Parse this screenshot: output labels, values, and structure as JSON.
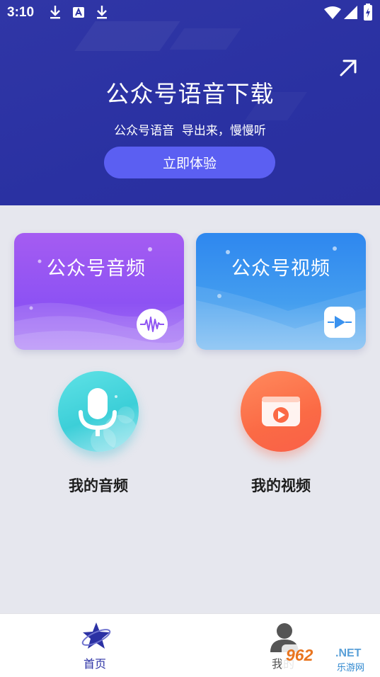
{
  "status_bar": {
    "time": "3:10",
    "left_icons": [
      "download-icon",
      "font-icon",
      "download-icon"
    ],
    "right_icons": [
      "wifi-icon",
      "signal-icon",
      "battery-icon"
    ]
  },
  "hero": {
    "title": "公众号语音下载",
    "subtitle": "公众号语音  导出来，慢慢听",
    "cta_label": "立即体验",
    "share_icon": "arrow-up-right-icon"
  },
  "cards": [
    {
      "label": "公众号音频",
      "icon": "waveform-icon",
      "color": "#9a58f3"
    },
    {
      "label": "公众号视频",
      "icon": "play-icon",
      "color": "#3a92ef"
    }
  ],
  "shortcuts": [
    {
      "label": "我的音频",
      "icon": "microphone-icon",
      "color": "#44d3dc"
    },
    {
      "label": "我的视频",
      "icon": "video-play-icon",
      "color": "#fb6f4a"
    }
  ],
  "bottom_nav": {
    "items": [
      {
        "label": "首页",
        "icon": "star-planet-icon",
        "active": true
      },
      {
        "label": "我的",
        "icon": "user-icon",
        "active": false
      }
    ]
  },
  "watermark": {
    "number": "962",
    "domain": ".NET",
    "text": "乐游网"
  },
  "colors": {
    "primary": "#2b31a4",
    "button": "#5b5ff2",
    "background": "#e6e7ee"
  }
}
